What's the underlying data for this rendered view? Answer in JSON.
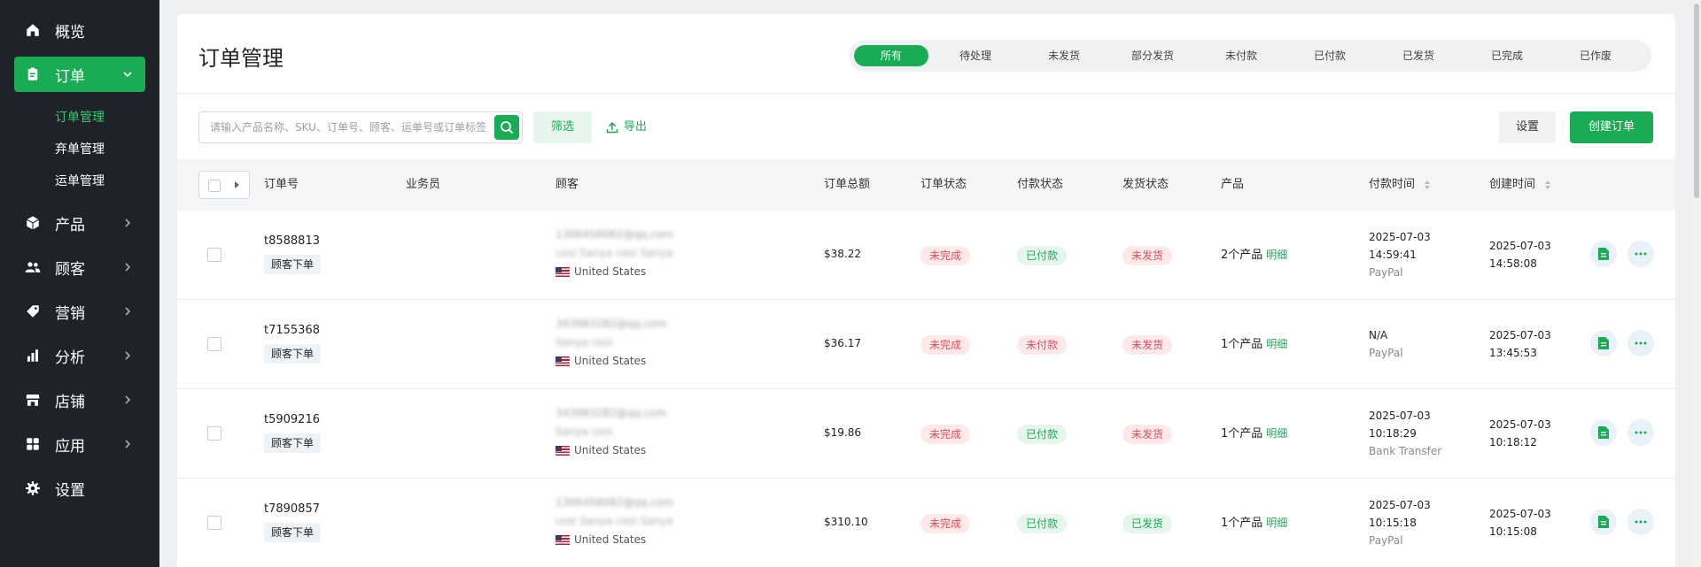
{
  "sidebar": {
    "items": [
      {
        "label": "概览",
        "icon": "home-icon"
      },
      {
        "label": "订单",
        "icon": "clipboard-icon",
        "active": true
      },
      {
        "label": "产品",
        "icon": "box-icon"
      },
      {
        "label": "顾客",
        "icon": "users-icon"
      },
      {
        "label": "营销",
        "icon": "tag-icon"
      },
      {
        "label": "分析",
        "icon": "bar-chart-icon"
      },
      {
        "label": "店铺",
        "icon": "store-icon"
      },
      {
        "label": "应用",
        "icon": "apps-icon"
      },
      {
        "label": "设置",
        "icon": "gear-icon"
      }
    ],
    "sub_items": [
      {
        "label": "订单管理",
        "active": true
      },
      {
        "label": "弃单管理"
      },
      {
        "label": "运单管理"
      }
    ]
  },
  "page": {
    "title": "订单管理"
  },
  "tabs": [
    "所有",
    "待处理",
    "未发货",
    "部分发货",
    "未付款",
    "已付款",
    "已发货",
    "已完成",
    "已作废"
  ],
  "toolbar": {
    "search_placeholder": "请输入产品名称、SKU、订单号、顾客、运单号或订单标签",
    "filter_label": "筛选",
    "export_label": "导出",
    "settings_label": "设置",
    "create_label": "创建订单"
  },
  "table": {
    "headers": {
      "order_no": "订单号",
      "salesperson": "业务员",
      "customer": "顾客",
      "total": "订单总额",
      "order_status": "订单状态",
      "payment_status": "付款状态",
      "shipping_status": "发货状态",
      "product": "产品",
      "paid_at": "付款时间",
      "created_at": "创建时间"
    },
    "rows": [
      {
        "order_id": "t8588813",
        "source": "顾客下单",
        "email": "1306458082@qq.com",
        "name": "cesi Sanya cesi Sanya",
        "country": "United States",
        "total": "$38.22",
        "order_status": "未完成",
        "payment_status": "已付款",
        "shipping_status": "未发货",
        "products": "2个产品",
        "detail": "明细",
        "paid_date": "2025-07-03",
        "paid_time": "14:59:41",
        "pay_method": "PayPal",
        "created_date": "2025-07-03",
        "created_time": "14:58:08"
      },
      {
        "order_id": "t7155368",
        "source": "顾客下单",
        "email": "343983282@qq.com",
        "name": "Sanya cesi",
        "country": "United States",
        "total": "$36.17",
        "order_status": "未完成",
        "payment_status": "未付款",
        "shipping_status": "未发货",
        "products": "1个产品",
        "detail": "明细",
        "paid_date": "N/A",
        "paid_time": "",
        "pay_method": "PayPal",
        "created_date": "2025-07-03",
        "created_time": "13:45:53"
      },
      {
        "order_id": "t5909216",
        "source": "顾客下单",
        "email": "343983282@qq.com",
        "name": "Sanya cesi",
        "country": "United States",
        "total": "$19.86",
        "order_status": "未完成",
        "payment_status": "已付款",
        "shipping_status": "未发货",
        "products": "1个产品",
        "detail": "明细",
        "paid_date": "2025-07-03",
        "paid_time": "10:18:29",
        "pay_method": "Bank Transfer",
        "created_date": "2025-07-03",
        "created_time": "10:18:12"
      },
      {
        "order_id": "t7890857",
        "source": "顾客下单",
        "email": "1306458082@qq.com",
        "name": "cesi Sanya cesi Sanya",
        "country": "United States",
        "total": "$310.10",
        "order_status": "未完成",
        "payment_status": "已付款",
        "shipping_status": "已发货",
        "products": "1个产品",
        "detail": "明细",
        "paid_date": "2025-07-03",
        "paid_time": "10:15:18",
        "pay_method": "PayPal",
        "created_date": "2025-07-03",
        "created_time": "10:15:08"
      }
    ]
  },
  "colors": {
    "accent": "#1aab55",
    "sidebar_bg": "#1f2329",
    "danger": "#e34d59"
  }
}
